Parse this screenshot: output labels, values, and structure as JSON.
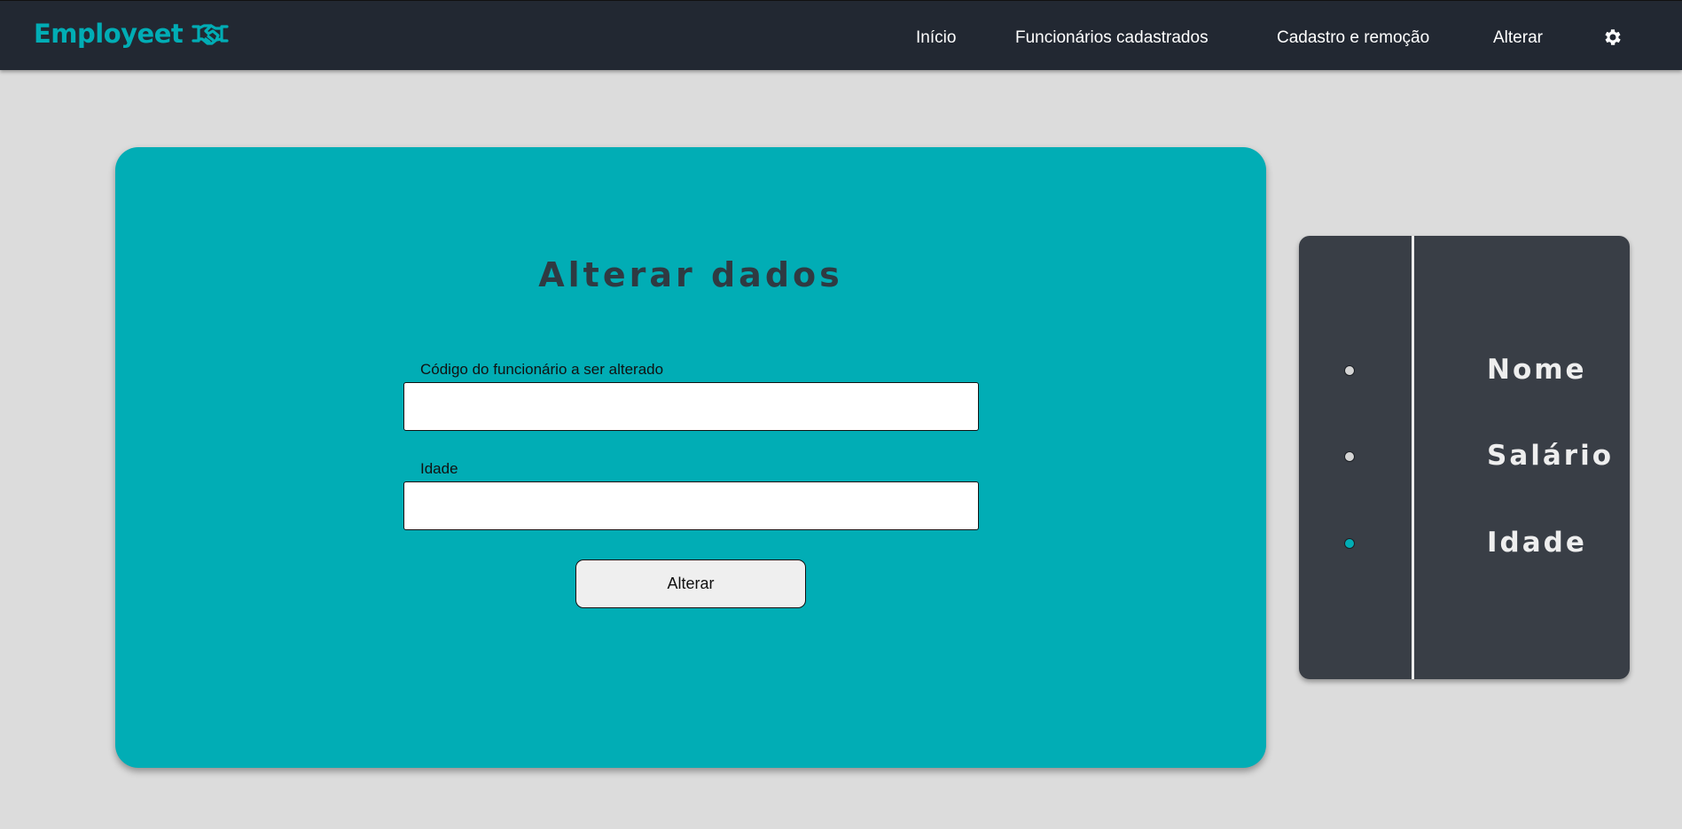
{
  "app": {
    "brand_name": "Employeet",
    "brand_icon": "handshake-icon",
    "accent_color": "#01adb5"
  },
  "nav": {
    "items": [
      {
        "label": "Início"
      },
      {
        "label": "Funcionários cadastrados"
      },
      {
        "label": "Cadastro e remoção"
      },
      {
        "label": "Alterar"
      }
    ],
    "settings_icon": "gear-icon"
  },
  "form": {
    "title": "Alterar dados",
    "fields": [
      {
        "label": "Código do funcionário a ser alterado",
        "value": "",
        "placeholder": ""
      },
      {
        "label": "Idade",
        "value": "",
        "placeholder": ""
      }
    ],
    "submit_label": "Alterar"
  },
  "selector": {
    "options": [
      {
        "label": "Nome",
        "selected": false
      },
      {
        "label": "Salário",
        "selected": false
      },
      {
        "label": "Idade",
        "selected": true
      }
    ]
  }
}
